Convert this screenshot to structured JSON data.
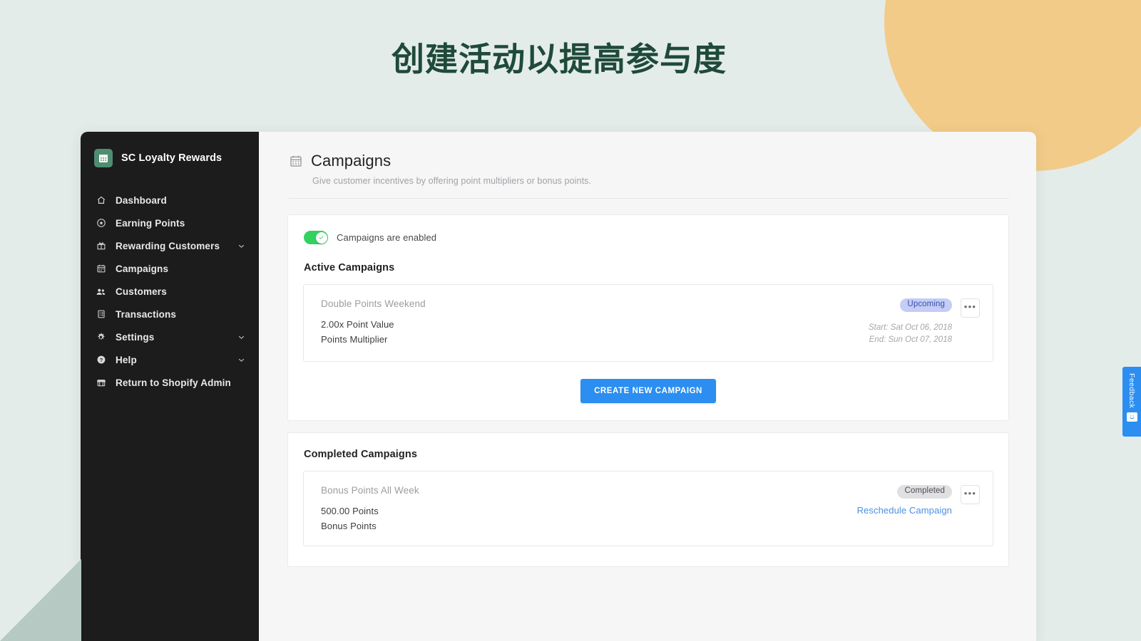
{
  "page": {
    "heading": "创建活动以提高参与度",
    "heading_color": "#1f4a3a",
    "background_color": "#e4ecea",
    "accent_circle_color": "#f2cb88",
    "accent_triangle_color": "#b6c9c3"
  },
  "sidebar": {
    "brand": {
      "name": "SC Loyalty Rewards",
      "logo_icon": "calendar-icon",
      "logo_color": "#4f8d71"
    },
    "items": [
      {
        "label": "Dashboard",
        "icon": "home-icon",
        "expandable": false
      },
      {
        "label": "Earning Points",
        "icon": "star-circle-icon",
        "expandable": false
      },
      {
        "label": "Rewarding Customers",
        "icon": "gift-icon",
        "expandable": true
      },
      {
        "label": "Campaigns",
        "icon": "calendar-icon",
        "expandable": false
      },
      {
        "label": "Customers",
        "icon": "people-icon",
        "expandable": false
      },
      {
        "label": "Transactions",
        "icon": "receipt-icon",
        "expandable": false
      },
      {
        "label": "Settings",
        "icon": "gear-icon",
        "expandable": true
      },
      {
        "label": "Help",
        "icon": "help-circle-icon",
        "expandable": true
      },
      {
        "label": "Return to Shopify Admin",
        "icon": "store-icon",
        "expandable": false
      }
    ],
    "caret_icon": "chevron-down-icon"
  },
  "content": {
    "title": "Campaigns",
    "title_icon": "calendar-icon",
    "subtitle": "Give customer incentives by offering point multipliers or bonus points."
  },
  "settings_panel": {
    "toggle": {
      "label": "Campaigns are enabled",
      "enabled": true,
      "on_color": "#33d15f",
      "knob_icon": "check-icon"
    },
    "active_section_title": "Active Campaigns",
    "active_campaigns": [
      {
        "name": "Double Points Weekend",
        "value": "2.00x Point Value",
        "type": "Points Multiplier",
        "status": "Upcoming",
        "status_color": "#3a4ea8",
        "start": "Start: Sat Oct 06, 2018",
        "end": "End: Sun Oct 07, 2018",
        "menu_icon": "ellipsis-icon"
      }
    ],
    "create_button": "CREATE NEW CAMPAIGN",
    "create_button_color": "#2b8ef0"
  },
  "completed_panel": {
    "section_title": "Completed Campaigns",
    "completed_campaigns": [
      {
        "name": "Bonus Points All Week",
        "value": "500.00 Points",
        "type": "Bonus Points",
        "status": "Completed",
        "status_color": "#4b4d51",
        "link": "Reschedule Campaign",
        "link_color": "#4a90e2",
        "menu_icon": "ellipsis-icon"
      }
    ]
  },
  "feedback": {
    "label": "Feedback",
    "icon": "smiley-icon",
    "color": "#2b8ef0"
  }
}
